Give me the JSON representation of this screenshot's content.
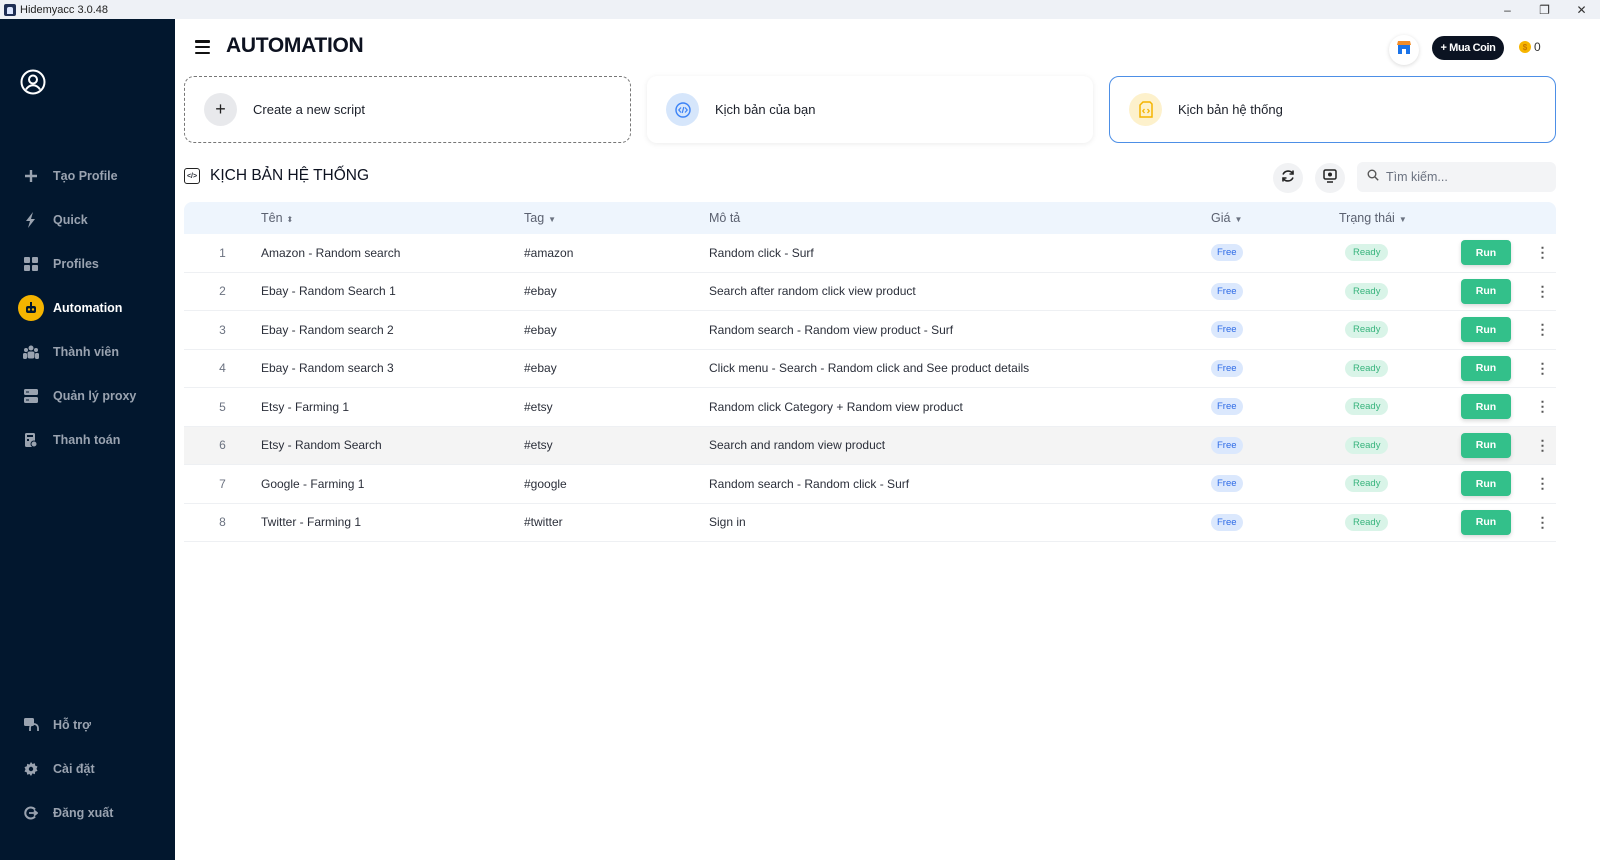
{
  "window": {
    "title": "Hidemyacc 3.0.48",
    "controls": {
      "minimize": "–",
      "restore": "❐",
      "close": "✕"
    }
  },
  "sidebar": {
    "top_items": [
      {
        "label": "Tạo Profile",
        "icon": "plus-icon",
        "active": false
      },
      {
        "label": "Quick",
        "icon": "bolt-icon",
        "active": false
      },
      {
        "label": "Profiles",
        "icon": "grid-icon",
        "active": false
      },
      {
        "label": "Automation",
        "icon": "robot-icon",
        "active": true
      },
      {
        "label": "Thành viên",
        "icon": "members-icon",
        "active": false
      },
      {
        "label": "Quản lý proxy",
        "icon": "server-icon",
        "active": false
      },
      {
        "label": "Thanh toán",
        "icon": "billing-icon",
        "active": false
      }
    ],
    "bottom_items": [
      {
        "label": "Hỗ trợ",
        "icon": "support-icon"
      },
      {
        "label": "Cài đặt",
        "icon": "gear-icon"
      },
      {
        "label": "Đăng xuất",
        "icon": "logout-icon"
      }
    ]
  },
  "header": {
    "title": "AUTOMATION",
    "buy_coin_label": "+ Mua Coin",
    "coin_balance": "0"
  },
  "cards": {
    "new_script": "Create a new script",
    "your_scripts": "Kịch bản của bạn",
    "system_scripts": "Kịch bản hệ thống"
  },
  "section": {
    "title": "KỊCH BẢN HỆ THỐNG",
    "search_placeholder": "Tìm kiếm..."
  },
  "table": {
    "columns": {
      "name": "Tên",
      "tag": "Tag",
      "description": "Mô tả",
      "price": "Giá",
      "status": "Trạng thái"
    },
    "run_label": "Run",
    "rows": [
      {
        "index": "1",
        "name": "Amazon - Random search",
        "tag": "#amazon",
        "description": "Random click - Surf",
        "price": "Free",
        "status": "Ready"
      },
      {
        "index": "2",
        "name": "Ebay - Random Search 1",
        "tag": "#ebay",
        "description": "Search after random click view product",
        "price": "Free",
        "status": "Ready"
      },
      {
        "index": "3",
        "name": "Ebay - Random search 2",
        "tag": "#ebay",
        "description": "Random search - Random view product - Surf",
        "price": "Free",
        "status": "Ready"
      },
      {
        "index": "4",
        "name": "Ebay - Random search 3",
        "tag": "#ebay",
        "description": "Click menu - Search - Random click and See product details",
        "price": "Free",
        "status": "Ready"
      },
      {
        "index": "5",
        "name": "Etsy - Farming 1",
        "tag": "#etsy",
        "description": "Random click Category + Random view product",
        "price": "Free",
        "status": "Ready"
      },
      {
        "index": "6",
        "name": "Etsy - Random Search",
        "tag": "#etsy",
        "description": "Search and random view product",
        "price": "Free",
        "status": "Ready"
      },
      {
        "index": "7",
        "name": "Google - Farming 1",
        "tag": "#google",
        "description": "Random search - Random click - Surf",
        "price": "Free",
        "status": "Ready"
      },
      {
        "index": "8",
        "name": "Twitter - Farming 1",
        "tag": "#twitter",
        "description": "Sign in",
        "price": "Free",
        "status": "Ready"
      }
    ]
  },
  "colors": {
    "sidebar_bg": "#02172e",
    "active_accent": "#f5b400",
    "run_green": "#33c08a",
    "free_blue": "#2e6be6",
    "ready_green": "#38b47d",
    "chat_blue": "#1b73e8"
  }
}
